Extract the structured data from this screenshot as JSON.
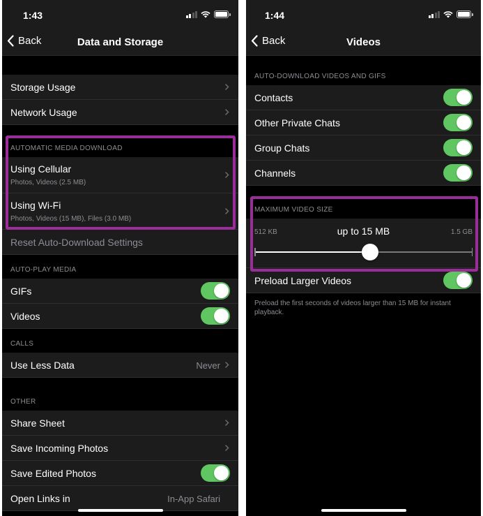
{
  "accent_color": "#9b2d9b",
  "toggle_color": "#5fc661",
  "left": {
    "status": {
      "time": "1:43"
    },
    "nav": {
      "back_label": "Back",
      "title": "Data and Storage"
    },
    "group1": [
      {
        "label": "Storage Usage"
      },
      {
        "label": "Network Usage"
      }
    ],
    "auto_media": {
      "header": "AUTOMATIC MEDIA DOWNLOAD",
      "rows": [
        {
          "label": "Using Cellular",
          "sub": "Photos, Videos (2.5 MB)"
        },
        {
          "label": "Using Wi-Fi",
          "sub": "Photos, Videos (15 MB), Files (3.0 MB)"
        }
      ],
      "reset": "Reset Auto-Download Settings"
    },
    "autoplay": {
      "header": "AUTO-PLAY MEDIA",
      "rows": [
        {
          "label": "GIFs",
          "on": true
        },
        {
          "label": "Videos",
          "on": true
        }
      ]
    },
    "calls": {
      "header": "CALLS",
      "row": {
        "label": "Use Less Data",
        "value": "Never"
      }
    },
    "other": {
      "header": "OTHER",
      "rows": [
        {
          "label": "Share Sheet"
        },
        {
          "label": "Save Incoming Photos"
        },
        {
          "label": "Save Edited Photos",
          "on": true
        },
        {
          "label": "Open Links in",
          "value": "In-App Safari"
        }
      ]
    }
  },
  "right": {
    "status": {
      "time": "1:44"
    },
    "nav": {
      "back_label": "Back",
      "title": "Videos"
    },
    "auto_download": {
      "header": "AUTO-DOWNLOAD VIDEOS AND GIFS",
      "rows": [
        {
          "label": "Contacts",
          "on": true
        },
        {
          "label": "Other Private Chats",
          "on": true
        },
        {
          "label": "Group Chats",
          "on": true
        },
        {
          "label": "Channels",
          "on": true
        }
      ]
    },
    "max_size": {
      "header": "MAXIMUM VIDEO SIZE",
      "min_label": "512 KB",
      "max_label": "1.5 GB",
      "current_label": "up to 15 MB",
      "slider_fraction": 0.53
    },
    "preload": {
      "label": "Preload Larger Videos",
      "on": true
    },
    "footnote": "Preload the first seconds of videos larger than 15 MB for instant playback."
  }
}
